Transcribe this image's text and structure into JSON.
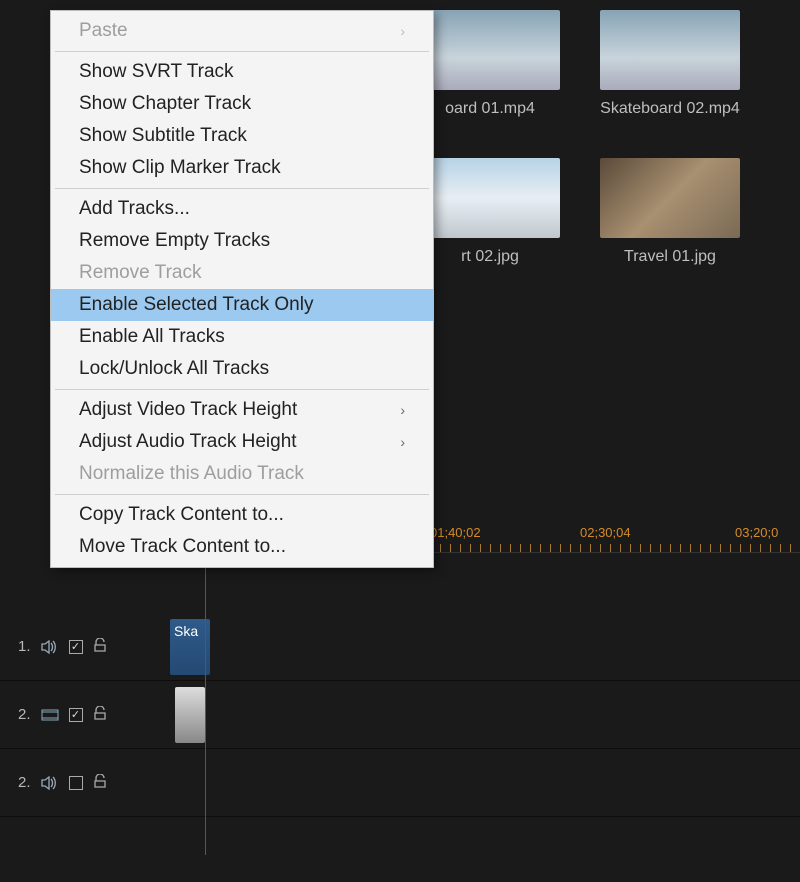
{
  "media": {
    "row1": [
      {
        "label": "oard 01.mp4"
      },
      {
        "label": "Skateboard 02.mp4"
      }
    ],
    "row2": [
      {
        "label": "rt 02.jpg"
      },
      {
        "label": "Travel 01.jpg"
      }
    ]
  },
  "menu": {
    "paste": "Paste",
    "show_svrt": "Show SVRT Track",
    "show_chapter": "Show Chapter Track",
    "show_subtitle": "Show Subtitle Track",
    "show_clip_marker": "Show Clip Marker Track",
    "add_tracks": "Add Tracks...",
    "remove_empty": "Remove Empty Tracks",
    "remove_track": "Remove Track",
    "enable_selected": "Enable Selected Track Only",
    "enable_all": "Enable All Tracks",
    "lock_unlock": "Lock/Unlock All Tracks",
    "adjust_video": "Adjust Video Track Height",
    "adjust_audio": "Adjust Audio Track Height",
    "normalize": "Normalize this Audio Track",
    "copy_content": "Copy Track Content to...",
    "move_content": "Move Track Content to..."
  },
  "ruler": {
    "t1": "01;40;02",
    "t2": "02;30;04",
    "t3": "03;20;0"
  },
  "tracks": {
    "t1": {
      "num": "1.",
      "checked": "✓",
      "clip": "Ska"
    },
    "t2": {
      "num": "2.",
      "checked": "✓"
    },
    "t3": {
      "num": "2.",
      "checked": ""
    }
  },
  "glyph": {
    "arrow_right": "›",
    "lock_open": "🔓",
    "speaker": "🔊",
    "film": "🎞"
  }
}
